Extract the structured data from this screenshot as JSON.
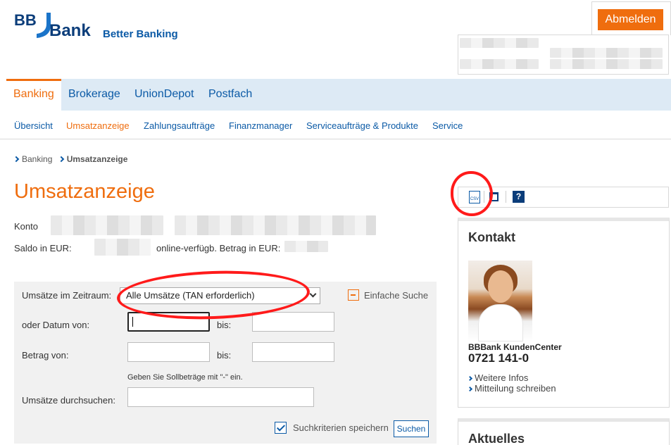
{
  "logo": {
    "bb": "BB",
    "bank": "Bank",
    "tagline": "Better Banking"
  },
  "header": {
    "logout_label": "Abmelden"
  },
  "main_nav": [
    {
      "label": "Banking",
      "active": true
    },
    {
      "label": "Brokerage"
    },
    {
      "label": "UnionDepot"
    },
    {
      "label": "Postfach"
    }
  ],
  "sub_nav": [
    {
      "label": "Übersicht"
    },
    {
      "label": "Umsatzanzeige",
      "current": true
    },
    {
      "label": "Zahlungsaufträge"
    },
    {
      "label": "Finanzmanager"
    },
    {
      "label": "Serviceaufträge & Produkte"
    },
    {
      "label": "Service"
    }
  ],
  "breadcrumb": {
    "items": [
      "Banking",
      "Umsatzanzeige"
    ]
  },
  "page_title": "Umsatzanzeige",
  "account": {
    "konto_label": "Konto",
    "saldo_label": "Saldo in EUR:",
    "available_label": "online-verfügb. Betrag in EUR:"
  },
  "search": {
    "period_label": "Umsätze im Zeitraum:",
    "period_value": "Alle Umsätze (TAN erforderlich)",
    "simple_search": "Einfache Suche",
    "date_from_label": "oder Datum von:",
    "to_label": "bis:",
    "amount_from_label": "Betrag von:",
    "hint": "Geben Sie Sollbeträge mit \"-\" ein.",
    "text_search_label": "Umsätze durchsuchen:",
    "save_criteria_label": "Suchkriterien speichern",
    "save_criteria_checked": true,
    "submit_label": "Suchen"
  },
  "toolbar": {
    "csv_label": "CSV",
    "help_label": "?"
  },
  "kontakt": {
    "title": "Kontakt",
    "center_name": "BBBank KundenCenter",
    "phone": "0721 141-0",
    "links": [
      "Weitere Infos",
      "Mitteilung schreiben"
    ]
  },
  "aktuelles": {
    "title": "Aktuelles"
  },
  "colors": {
    "brand_orange": "#ef6d0e",
    "brand_blue": "#0b5aa6",
    "nav_bg": "#ddeaf5",
    "annotation_red": "#ff1a1a"
  }
}
